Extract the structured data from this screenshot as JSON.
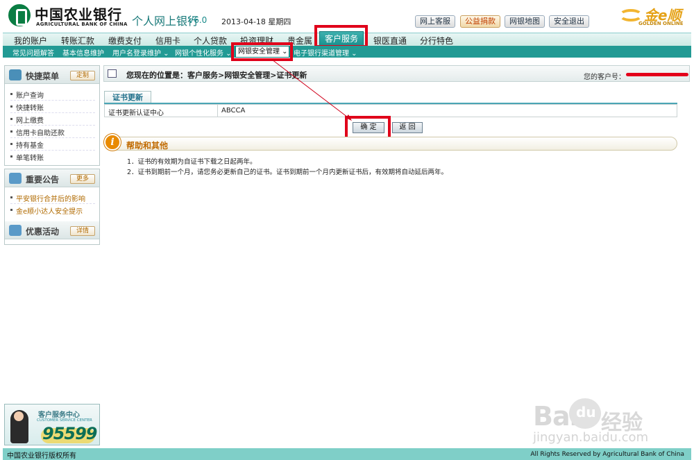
{
  "header": {
    "bank_name_cn": "中国农业银行",
    "bank_name_en": "AGRICULTURAL BANK OF CHINA",
    "site_title": "个人网上银行",
    "version": "V6.0",
    "date": "2013-04-18 星期四",
    "buttons": [
      "网上客服",
      "公益捐款",
      "网银地图",
      "安全退出"
    ],
    "partner_logo_cn": "金e顺",
    "partner_logo_en": "GOLDEN ONLINE"
  },
  "main_nav": {
    "items": [
      "我的账户",
      "转账汇款",
      "缴费支付",
      "信用卡",
      "个人贷款",
      "投资理财",
      "贵金属",
      "客户服务",
      "银医直通",
      "分行特色"
    ],
    "active": "客户服务"
  },
  "sub_nav": {
    "items": [
      "常见问题解答",
      "基本信息维护",
      "用户名登录维护 ⌄",
      "网银个性化服务 ⌄",
      "网银安全管理 ⌄",
      "电子银行渠道管理 ⌄"
    ],
    "active": "网银安全管理 ⌄"
  },
  "sidebar": {
    "quick_menu": {
      "title": "快捷菜单",
      "button": "定制",
      "items": [
        "账户查询",
        "快捷转账",
        "网上缴费",
        "信用卡自助还款",
        "持有基金",
        "单笔转账"
      ]
    },
    "notices": {
      "title": "重要公告",
      "button": "更多",
      "items": [
        "平安银行合并后的影响",
        "金e顺小达人安全提示"
      ]
    },
    "promotions": {
      "title": "优惠活动",
      "button": "详情"
    }
  },
  "breadcrumb": {
    "text": "您现在的位置是：客户服务>网银安全管理>证书更新",
    "customer_label": "您的客户号："
  },
  "panel": {
    "tab": "证书更新",
    "field_label": "证书更新认证中心",
    "field_value": "ABCCA",
    "confirm_button": "确 定",
    "back_button": "返 回"
  },
  "help": {
    "title": "帮助和其他",
    "lines": [
      "1．证书的有效期为自证书下载之日起两年。",
      "2．证书到期前一个月，请您务必更新自己的证书。证书到期前一个月内更新证书后，有效期将自动延后两年。"
    ]
  },
  "customer_service": {
    "title": "客户服务中心",
    "subtitle": "CUSTOMER SERVICE CENTER",
    "phone": "95599"
  },
  "footer": {
    "left": "中国农业银行版权所有",
    "right": "All Rights Reserved by Agricultural Bank of China"
  },
  "watermark": {
    "brand": "Bai",
    "brand_tail": "du",
    "product": "经验",
    "url": "jingyan.baidu.com"
  },
  "colors": {
    "highlight_box": "#e0001a",
    "nav_teal": "#229a94",
    "brand_green": "#0a7d43"
  }
}
